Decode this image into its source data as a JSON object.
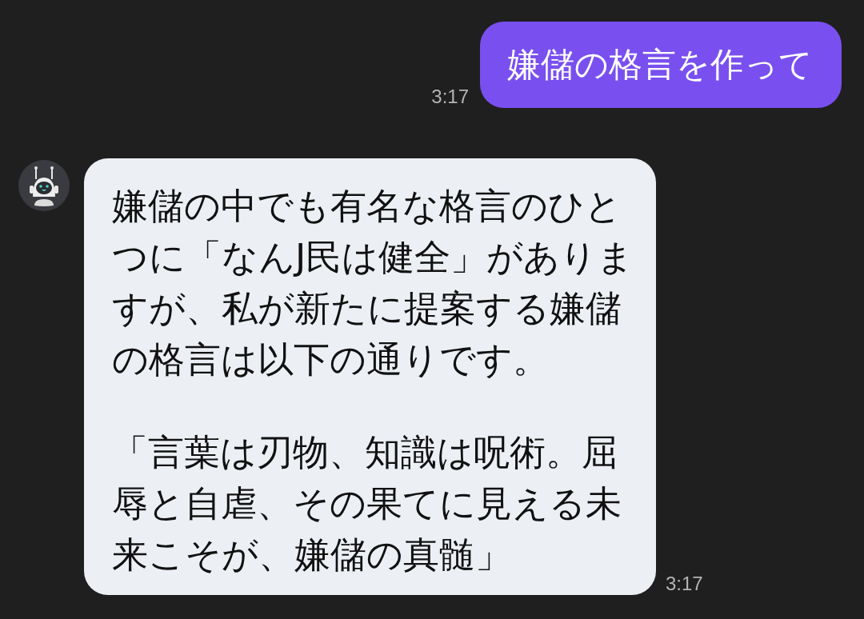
{
  "messages": [
    {
      "kind": "user",
      "paragraphs": [
        "嫌儲の格言を作って"
      ],
      "time": "3:17"
    },
    {
      "kind": "bot",
      "paragraphs": [
        "嫌儲の中でも有名な格言のひとつに「なんJ民は健全」がありますが、私が新たに提案する嫌儲の格言は以下の通りです。",
        "「言葉は刃物、知識は呪術。屈辱と自虐、その果てに見える未来こそが、嫌儲の真髄」"
      ],
      "time": "3:17"
    }
  ]
}
